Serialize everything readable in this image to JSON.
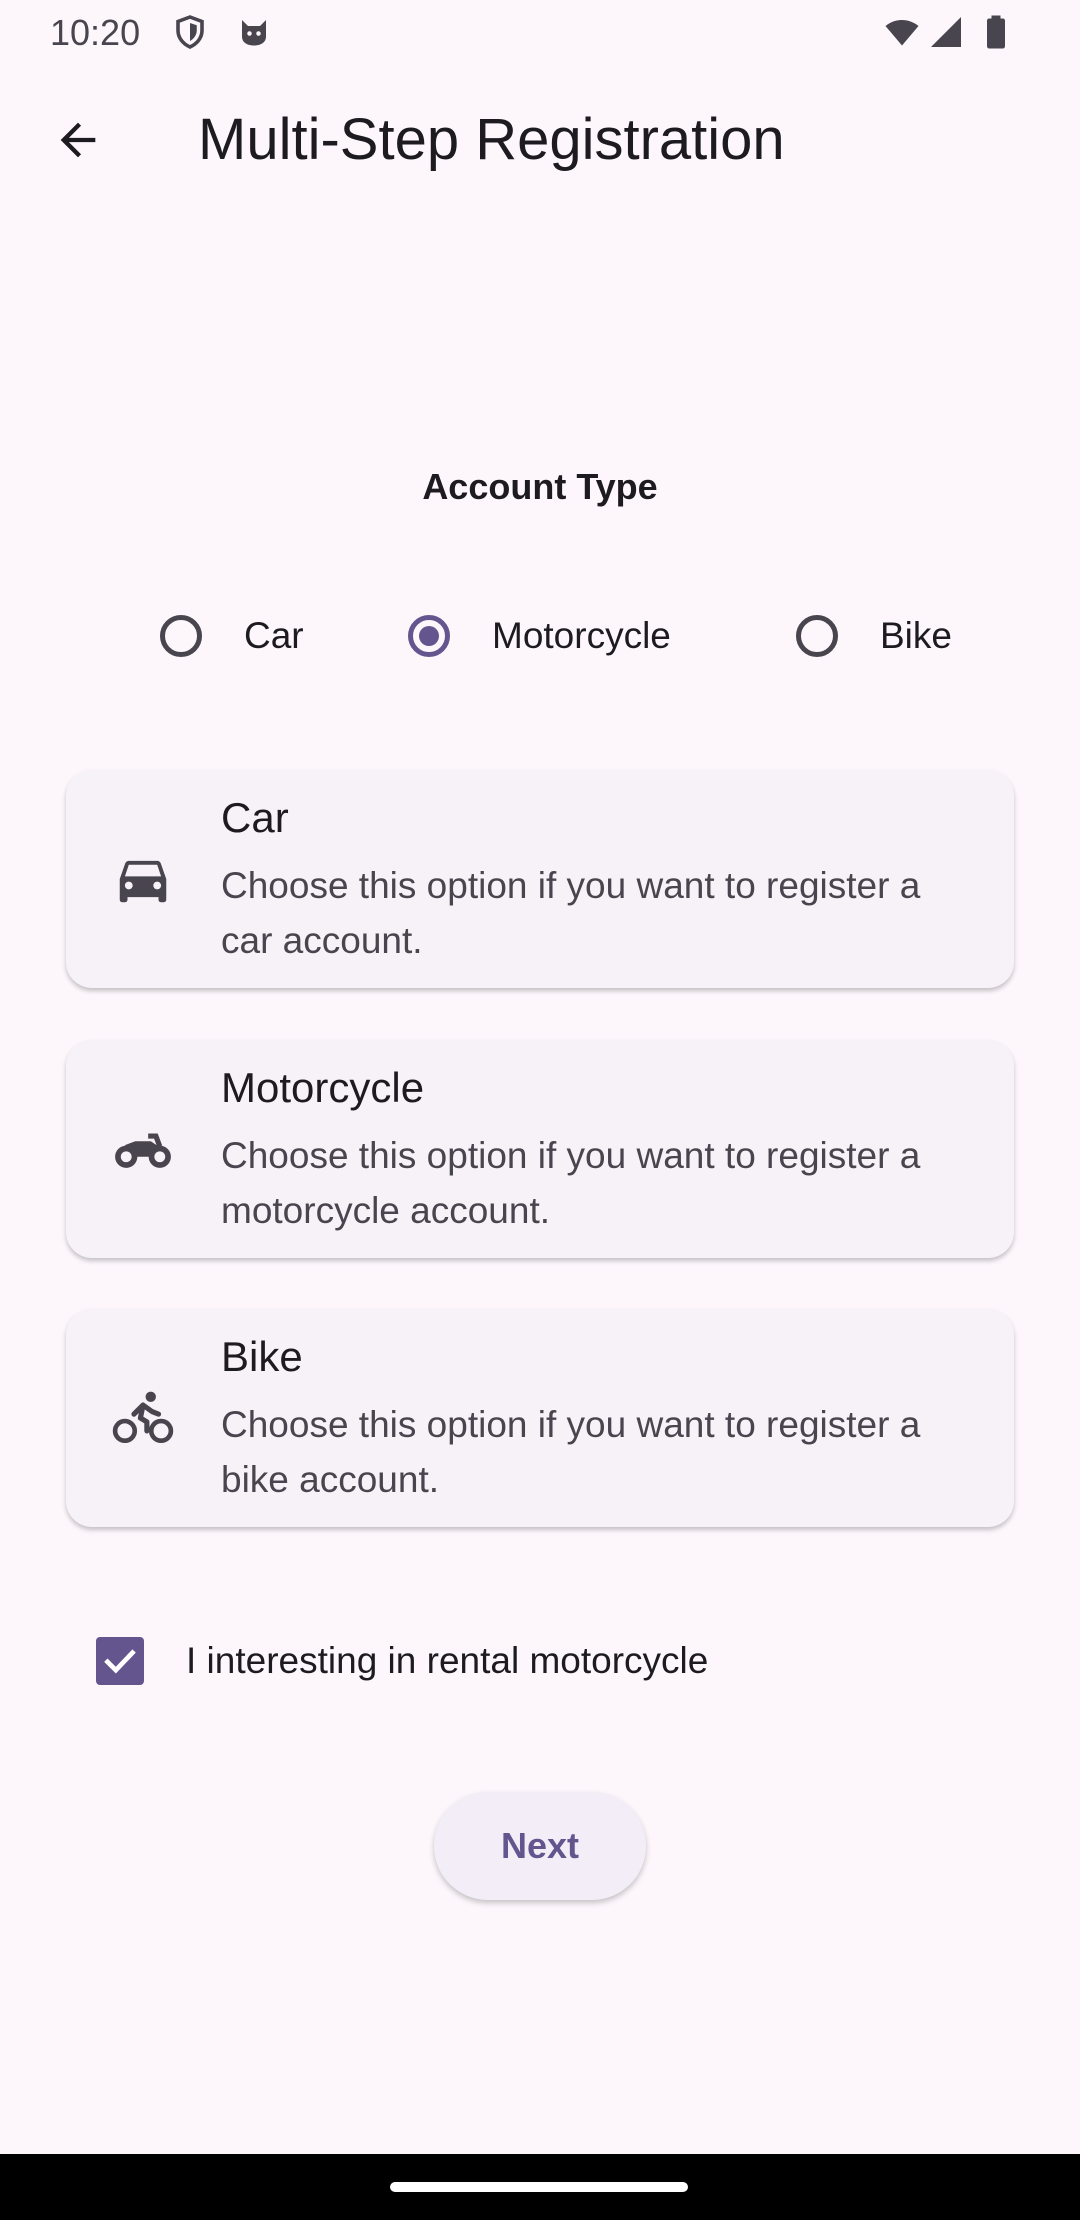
{
  "status_bar": {
    "time": "10:20",
    "left_icons": [
      "shield-icon",
      "cat-icon"
    ],
    "right_icons": [
      "wifi-icon",
      "signal-icon",
      "battery-icon"
    ]
  },
  "app_bar": {
    "back_icon": "arrow-back-icon",
    "title": "Multi-Step Registration"
  },
  "section_title": "Account Type",
  "radios": [
    {
      "label": "Car",
      "checked": false
    },
    {
      "label": "Motorcycle",
      "checked": true
    },
    {
      "label": "Bike",
      "checked": false
    }
  ],
  "cards": [
    {
      "icon": "car-icon",
      "title": "Car",
      "description": "Choose this option if you want to register a car account."
    },
    {
      "icon": "motorcycle-icon",
      "title": "Motorcycle",
      "description": "Choose this option if you want to register a motorcycle account."
    },
    {
      "icon": "bike-icon",
      "title": "Bike",
      "description": "Choose this option if you want to register a bike account."
    }
  ],
  "checkbox": {
    "label": "I interesting in rental motorcycle",
    "checked": true
  },
  "next_button": "Next",
  "colors": {
    "primary": "#65558f",
    "background": "#fdf7fc",
    "card": "#f7f2f8"
  }
}
